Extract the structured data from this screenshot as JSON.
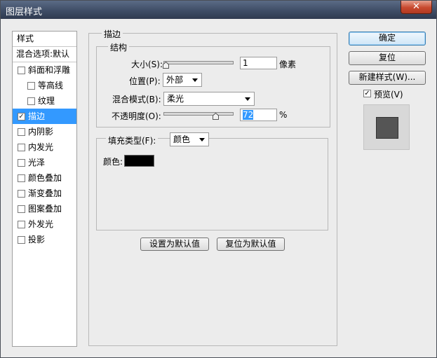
{
  "window": {
    "title": "图层样式",
    "close_glyph": "✕"
  },
  "left_panel": {
    "header": "样式",
    "blend_options": "混合选项:默认",
    "items": [
      {
        "label": "斜面和浮雕",
        "checked": false
      },
      {
        "label": "等高线",
        "checked": false
      },
      {
        "label": "纹理",
        "checked": false
      },
      {
        "label": "描边",
        "checked": true
      },
      {
        "label": "内阴影",
        "checked": false
      },
      {
        "label": "内发光",
        "checked": false
      },
      {
        "label": "光泽",
        "checked": false
      },
      {
        "label": "颜色叠加",
        "checked": false
      },
      {
        "label": "渐变叠加",
        "checked": false
      },
      {
        "label": "图案叠加",
        "checked": false
      },
      {
        "label": "外发光",
        "checked": false
      },
      {
        "label": "投影",
        "checked": false
      }
    ]
  },
  "stroke": {
    "title": "描边",
    "structure": {
      "title": "结构",
      "size_label": "大小(S):",
      "size_value": "1",
      "size_unit": "像素",
      "size_slider_fraction": 0.0,
      "position_label": "位置(P):",
      "position_value": "外部",
      "blend_mode_label": "混合模式(B):",
      "blend_mode_value": "柔光",
      "opacity_label": "不透明度(O):",
      "opacity_value": "72",
      "opacity_unit": "%",
      "opacity_slider_fraction": 0.72
    },
    "fill": {
      "fill_type_label": "填充类型(F):",
      "fill_type_value": "颜色",
      "color_label": "颜色:",
      "color_swatch": "#000000"
    },
    "make_default_button": "设置为默认值",
    "reset_default_button": "复位为默认值"
  },
  "buttons": {
    "ok": "确定",
    "reset": "复位",
    "new_style": "新建样式(W)...",
    "preview_label": "预览(V)",
    "preview_checked": true
  },
  "colors": {
    "selection": "#3399ff",
    "title_bar": "#3f4d66",
    "close_button": "#c8492e"
  },
  "check_glyph": "✓"
}
